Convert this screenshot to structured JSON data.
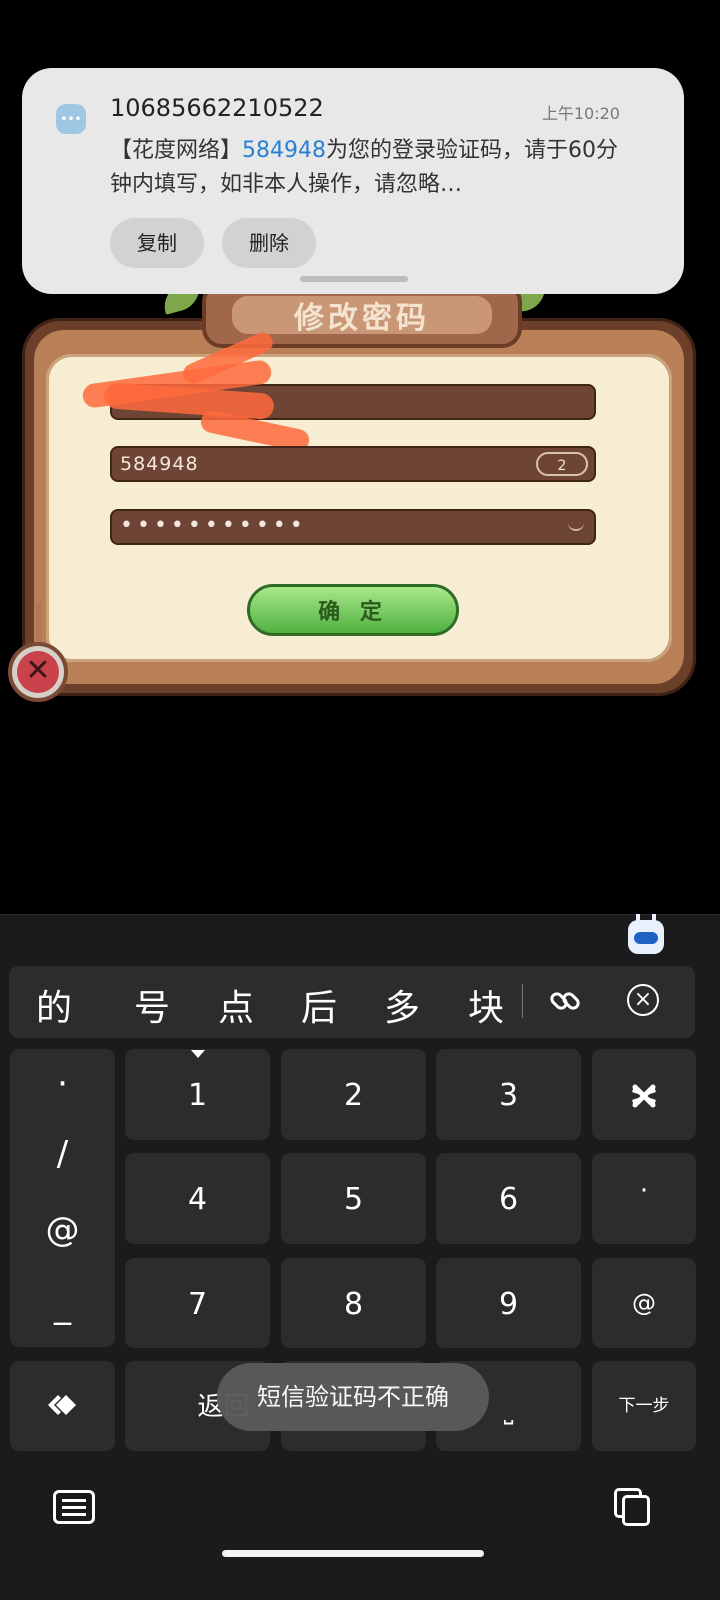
{
  "notification": {
    "sender": "10685662210522",
    "time": "上午10:20",
    "body_prefix": "【花度网络】",
    "code": "584948",
    "body_suffix": "为您的登录验证码，请于60分钟内填写，如非本人操作，请忽略…",
    "copy_label": "复制",
    "delete_label": "删除"
  },
  "dialog": {
    "title": "修改密码",
    "code_value": "584948",
    "countdown": "2",
    "password_mask": "•••••••••••",
    "confirm_label": "确 定"
  },
  "keyboard": {
    "candidates": [
      "的",
      "号",
      "点",
      "后",
      "多",
      "块"
    ],
    "symbols": [
      "·",
      "/",
      "@",
      "_"
    ],
    "keys": [
      "1",
      "2",
      "3",
      "4",
      "5",
      "6",
      "7",
      "8",
      "9"
    ],
    "side_keys": [
      "·",
      "@"
    ],
    "back_label": "返回",
    "space_label": "⎵",
    "next_label": "下一步"
  },
  "toast": "短信验证码不正确",
  "colors": {
    "accent_code": "#2a80d4",
    "confirm_green": "#4fb141",
    "field_brown": "#6e4535"
  }
}
